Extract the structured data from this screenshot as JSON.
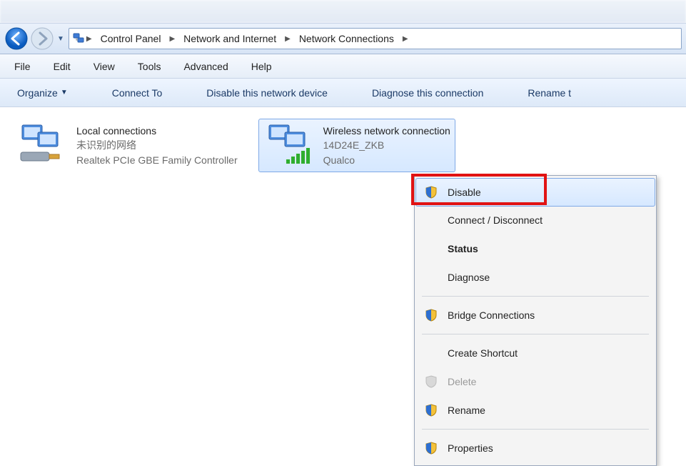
{
  "breadcrumb": {
    "root": "Control Panel",
    "mid": "Network and Internet",
    "leaf": "Network Connections"
  },
  "menubar": {
    "file": "File",
    "edit": "Edit",
    "view": "View",
    "tools": "Tools",
    "advanced": "Advanced",
    "help": "Help"
  },
  "cmdbar": {
    "organize": "Organize",
    "connect_to": "Connect To",
    "disable": "Disable this network device",
    "diagnose": "Diagnose this connection",
    "rename": "Rename t"
  },
  "connections": {
    "local": {
      "title": "Local connections",
      "sub1": "未识别的网络",
      "sub2": "Realtek PCIe GBE Family Controller"
    },
    "wireless": {
      "title": "Wireless network connection",
      "sub1": "14D24E_ZKB",
      "sub2": "Qualco"
    }
  },
  "ctx": {
    "disable": "Disable",
    "connect": "Connect / Disconnect",
    "status": "Status",
    "diagnose": "Diagnose",
    "bridge": "Bridge Connections",
    "shortcut": "Create Shortcut",
    "delete": "Delete",
    "rename": "Rename",
    "properties": "Properties"
  }
}
